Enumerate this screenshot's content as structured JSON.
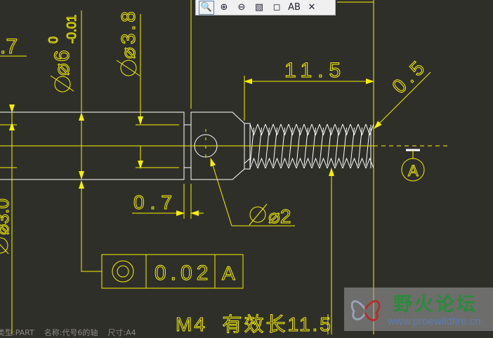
{
  "toolbar": {
    "buttons": [
      {
        "icon": "zoom-window-icon",
        "glyph": "🔍"
      },
      {
        "icon": "zoom-in-icon",
        "glyph": "⊕"
      },
      {
        "icon": "zoom-out-icon",
        "glyph": "⊖"
      },
      {
        "icon": "repaint-icon",
        "glyph": "▧"
      },
      {
        "icon": "display-style-icon",
        "glyph": "◻"
      },
      {
        "icon": "annotation-display-icon",
        "glyph": "AB"
      },
      {
        "icon": "datum-display-icon",
        "glyph": "✕"
      }
    ]
  },
  "drawing": {
    "dim_left_partial": ".7",
    "dim_dia6": "⌀6",
    "dim_dia6_tol_upper": "0",
    "dim_dia6_tol_lower": "-0.01",
    "dim_dia38": "⌀3.8",
    "dim_left_bottom": "⌀3.0",
    "dim_thread_length": "11.5",
    "dim_chamfer": "0.5",
    "dim_neck": "0.7",
    "dim_hole": "⌀2",
    "datum_label": "A",
    "fcf_tolerance": "0.02",
    "fcf_datum": "A",
    "thread_note": "M4  有效长11.5"
  },
  "watermark": {
    "title": "野火论坛",
    "url": "www.proewildfire.cn"
  },
  "status": {
    "text": "类型:PART    名称:代号6的轴    尺寸:A4"
  },
  "colors": {
    "background": "#2f2f2a",
    "dimension": "#f5f000",
    "geometry": "#ffffff"
  }
}
